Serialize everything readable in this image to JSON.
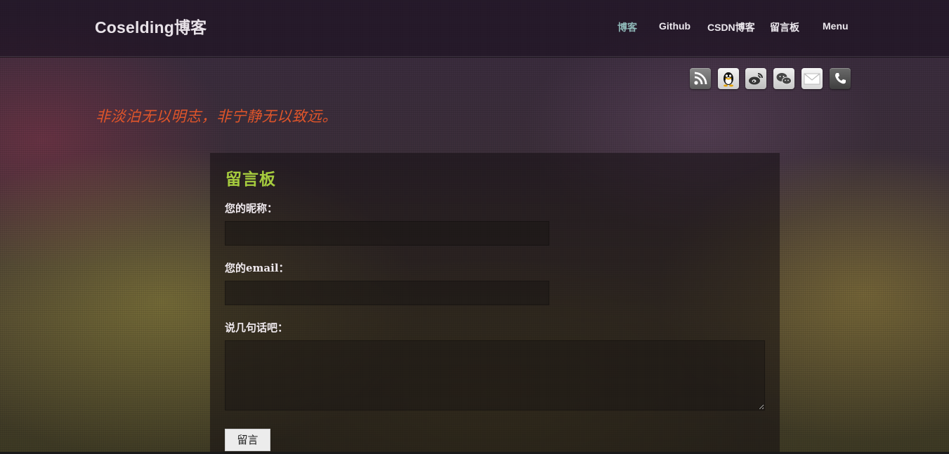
{
  "site": {
    "title": "Coselding博客"
  },
  "nav": {
    "items": [
      {
        "label": "博客",
        "active": true
      },
      {
        "label": "Github",
        "active": false
      },
      {
        "label": "CSDN博客",
        "active": false
      },
      {
        "label": "留言板",
        "active": false
      },
      {
        "label": "Menu",
        "active": false
      }
    ]
  },
  "social": {
    "icons": [
      "rss-icon",
      "qq-icon",
      "weibo-icon",
      "wechat-icon",
      "mail-icon",
      "phone-icon"
    ]
  },
  "motto": "非淡泊无以明志，非宁静无以致远。",
  "guestbook": {
    "title": "留言板",
    "nickname_label": "您的昵称：",
    "nickname_value": "",
    "email_label": "您的email：",
    "email_value": "",
    "message_label": "说几句话吧：",
    "message_value": "",
    "submit_label": "留言"
  },
  "colors": {
    "motto": "#e0552a",
    "title_accent": "#a6cc3e",
    "nav_active": "#8fb8b8"
  }
}
